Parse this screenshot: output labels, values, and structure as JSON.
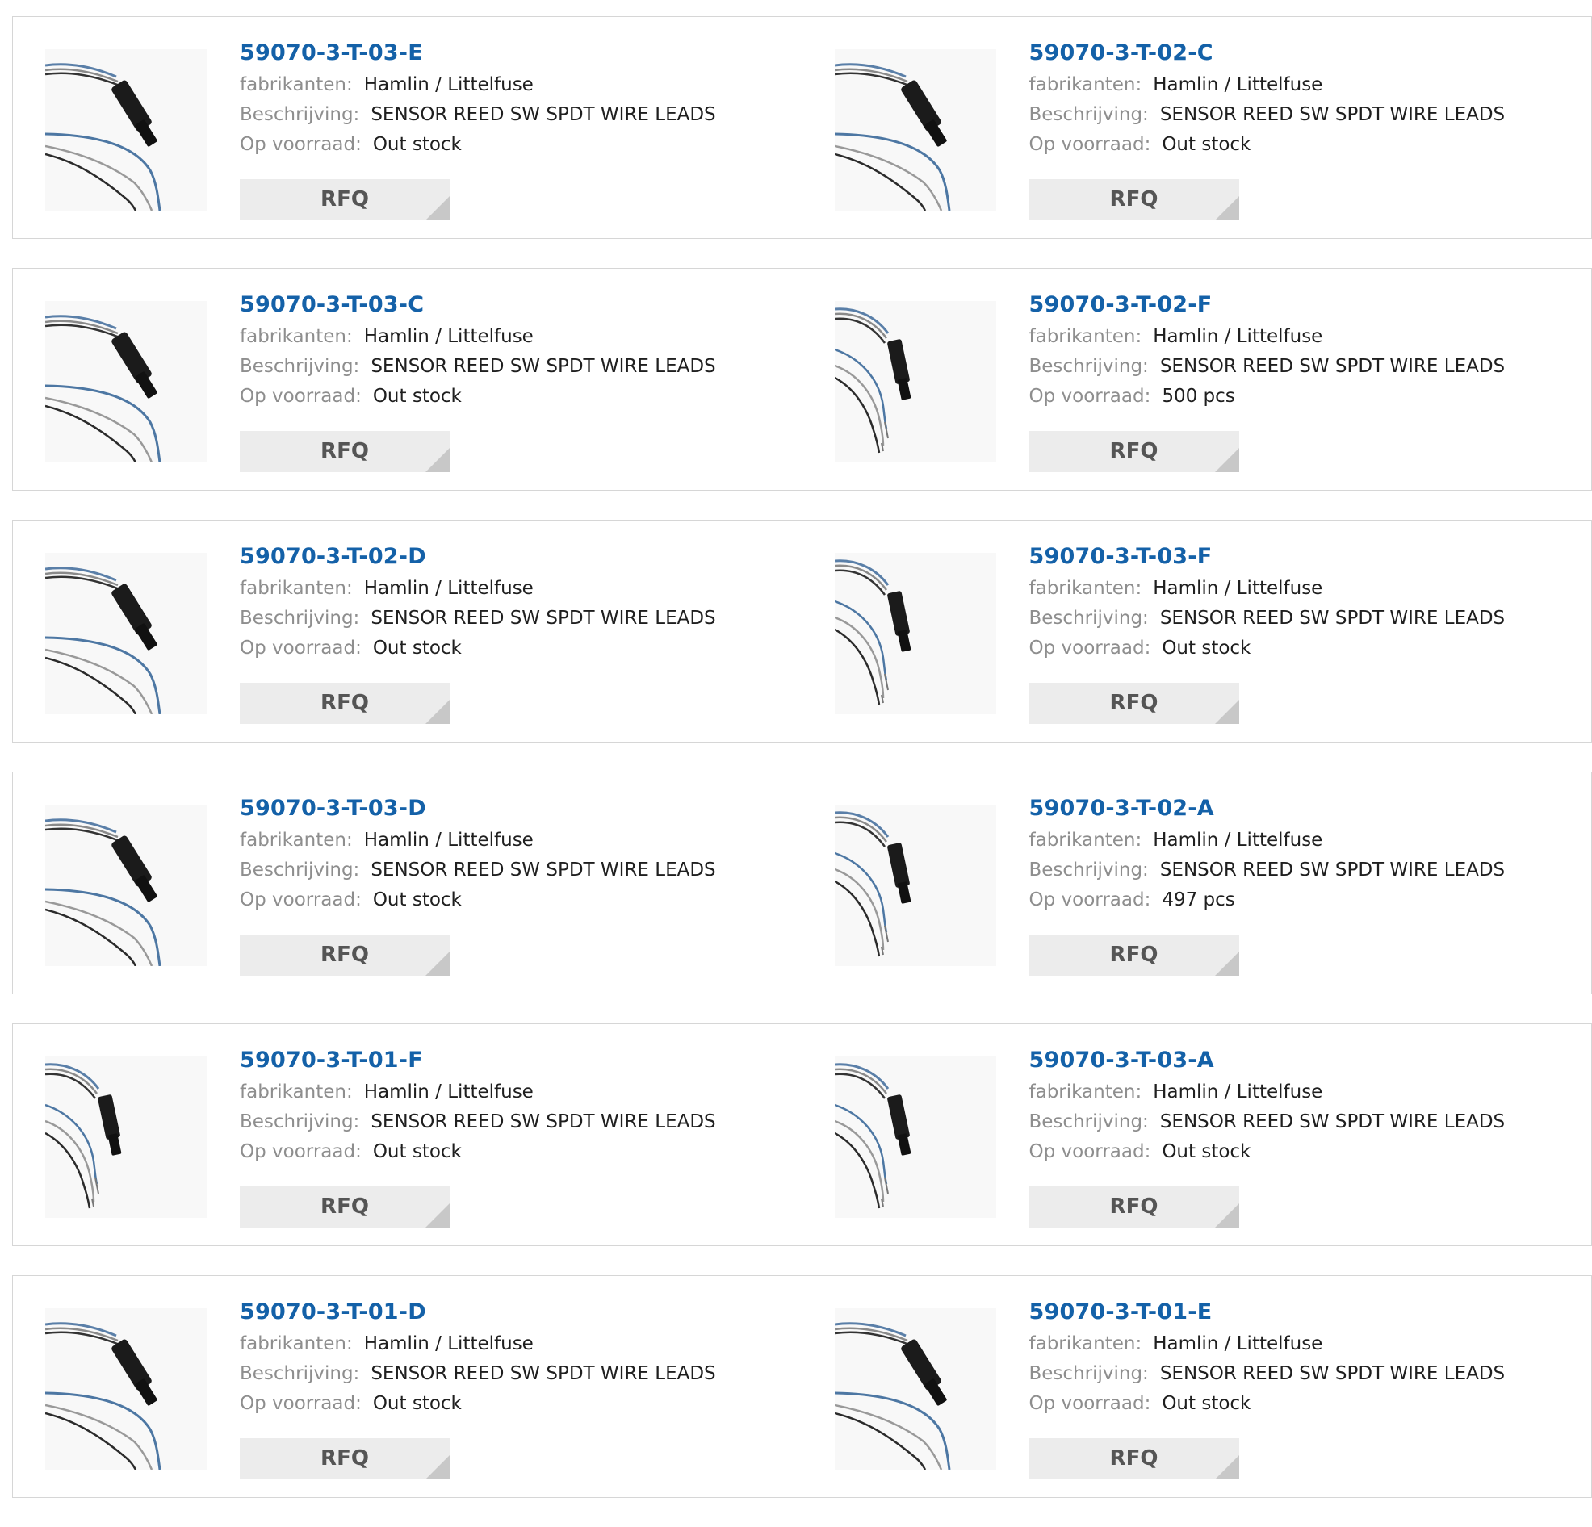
{
  "labels": {
    "manufacturer": "fabrikanten:",
    "description": "Beschrijving:",
    "stock": "Op voorraad:",
    "rfq": "RFQ"
  },
  "colors": {
    "part_link": "#1461a8",
    "label": "#8e8e8e",
    "value": "#1f1f1f",
    "rfq_bg": "#ececec",
    "rfq_text": "#555555",
    "border": "#d6d6d6"
  },
  "products": [
    {
      "part": "59070-3-T-03-E",
      "manufacturer": "Hamlin / Littelfuse",
      "description": "SENSOR REED SW SPDT WIRE LEADS",
      "stock": "Out stock",
      "image_icon": "sensor-long-leads-photo"
    },
    {
      "part": "59070-3-T-02-C",
      "manufacturer": "Hamlin / Littelfuse",
      "description": "SENSOR REED SW SPDT WIRE LEADS",
      "stock": "Out stock",
      "image_icon": "sensor-long-leads-photo"
    },
    {
      "part": "59070-3-T-03-C",
      "manufacturer": "Hamlin / Littelfuse",
      "description": "SENSOR REED SW SPDT WIRE LEADS",
      "stock": "Out stock",
      "image_icon": "sensor-long-leads-photo"
    },
    {
      "part": "59070-3-T-02-F",
      "manufacturer": "Hamlin / Littelfuse",
      "description": "SENSOR REED SW SPDT WIRE LEADS",
      "stock": "500 pcs",
      "image_icon": "sensor-short-leads-photo"
    },
    {
      "part": "59070-3-T-02-D",
      "manufacturer": "Hamlin / Littelfuse",
      "description": "SENSOR REED SW SPDT WIRE LEADS",
      "stock": "Out stock",
      "image_icon": "sensor-long-leads-photo"
    },
    {
      "part": "59070-3-T-03-F",
      "manufacturer": "Hamlin / Littelfuse",
      "description": "SENSOR REED SW SPDT WIRE LEADS",
      "stock": "Out stock",
      "image_icon": "sensor-short-leads-photo"
    },
    {
      "part": "59070-3-T-03-D",
      "manufacturer": "Hamlin / Littelfuse",
      "description": "SENSOR REED SW SPDT WIRE LEADS",
      "stock": "Out stock",
      "image_icon": "sensor-long-leads-photo"
    },
    {
      "part": "59070-3-T-02-A",
      "manufacturer": "Hamlin / Littelfuse",
      "description": "SENSOR REED SW SPDT WIRE LEADS",
      "stock": "497 pcs",
      "image_icon": "sensor-short-leads-photo"
    },
    {
      "part": "59070-3-T-01-F",
      "manufacturer": "Hamlin / Littelfuse",
      "description": "SENSOR REED SW SPDT WIRE LEADS",
      "stock": "Out stock",
      "image_icon": "sensor-short-leads-photo"
    },
    {
      "part": "59070-3-T-03-A",
      "manufacturer": "Hamlin / Littelfuse",
      "description": "SENSOR REED SW SPDT WIRE LEADS",
      "stock": "Out stock",
      "image_icon": "sensor-short-leads-photo"
    },
    {
      "part": "59070-3-T-01-D",
      "manufacturer": "Hamlin / Littelfuse",
      "description": "SENSOR REED SW SPDT WIRE LEADS",
      "stock": "Out stock",
      "image_icon": "sensor-long-leads-photo"
    },
    {
      "part": "59070-3-T-01-E",
      "manufacturer": "Hamlin / Littelfuse",
      "description": "SENSOR REED SW SPDT WIRE LEADS",
      "stock": "Out stock",
      "image_icon": "sensor-long-leads-photo"
    }
  ]
}
